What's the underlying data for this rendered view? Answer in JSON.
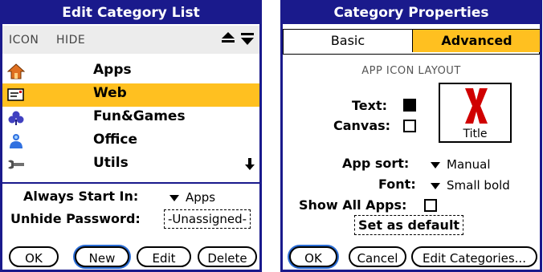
{
  "left": {
    "title": "Edit Category List",
    "col_icon": "ICON",
    "col_hide": "HIDE",
    "up_arrow": "⏶",
    "down_arrow": "⏷",
    "items": [
      {
        "label": "Apps",
        "icon": "house-icon",
        "selected": false
      },
      {
        "label": "Web",
        "icon": "mail-card-icon",
        "selected": true
      },
      {
        "label": "Fun&Games",
        "icon": "clover-icon",
        "selected": false
      },
      {
        "label": "Office",
        "icon": "people-icon",
        "selected": false
      },
      {
        "label": "Utils",
        "icon": "wrench-icon",
        "selected": false
      }
    ],
    "scroll_down": "⬇",
    "always_start_label": "Always Start In:",
    "always_start_value": "Apps",
    "unhide_label": "Unhide Password:",
    "unhide_value": "-Unassigned-",
    "buttons": {
      "ok": "OK",
      "new": "New",
      "edit": "Edit",
      "delete": "Delete"
    }
  },
  "right": {
    "title": "Category Properties",
    "tabs": {
      "basic": "Basic",
      "advanced": "Advanced"
    },
    "section": "APP ICON LAYOUT",
    "text_label": "Text:",
    "text_checked": true,
    "canvas_label": "Canvas:",
    "canvas_checked": false,
    "preview_title": "Title",
    "app_sort_label": "App sort:",
    "app_sort_value": "Manual",
    "font_label": "Font:",
    "font_value": "Small bold",
    "show_all_label": "Show All Apps:",
    "show_all_checked": false,
    "set_default": "Set as default",
    "buttons": {
      "ok": "OK",
      "cancel": "Cancel",
      "edit_categories": "Edit Categories..."
    }
  },
  "colors": {
    "title_bar": "#1a1a8c",
    "highlight": "#ffc020"
  }
}
